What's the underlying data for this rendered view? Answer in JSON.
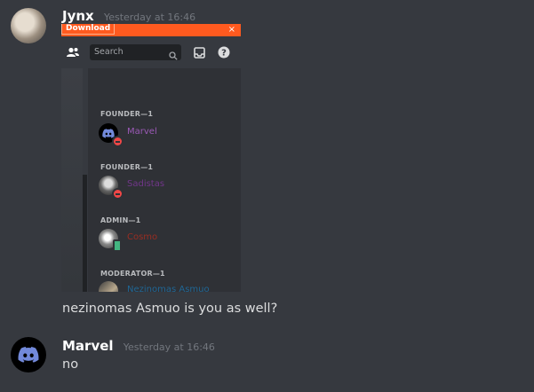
{
  "messages": [
    {
      "author": "Jynx",
      "timestamp": "Yesterday at 16:46",
      "text": "nezinomas Asmuo is you as well?"
    },
    {
      "author": "Marvel",
      "timestamp": "Yesterday at 16:46",
      "text": "no"
    }
  ],
  "embed": {
    "download_label": "Download",
    "close_glyph": "×",
    "search_placeholder": "Search",
    "icons": [
      "members-icon",
      "search-icon",
      "inbox-icon",
      "help-icon"
    ],
    "roles": [
      {
        "heading": "FOUNDER—1",
        "member": "Marvel",
        "color": "#9b59b6",
        "status": "dnd"
      },
      {
        "heading": "FOUNDER—1",
        "member": "Sadistas",
        "color": "#71368a",
        "status": "dnd"
      },
      {
        "heading": "ADMIN—1",
        "member": "Cosmo",
        "color": "#992d22",
        "status": "mobile"
      },
      {
        "heading": "MODERATOR—1",
        "member": "Nezinomas Asmuo",
        "color": "#206694",
        "status": "dnd"
      }
    ]
  },
  "colors": {
    "background": "#36393f",
    "username": "#ffffff",
    "timestamp": "#72767d",
    "message_text": "#dcddde",
    "accent_orange": "#ff5a1f",
    "discord_blurple": "#7289da"
  }
}
